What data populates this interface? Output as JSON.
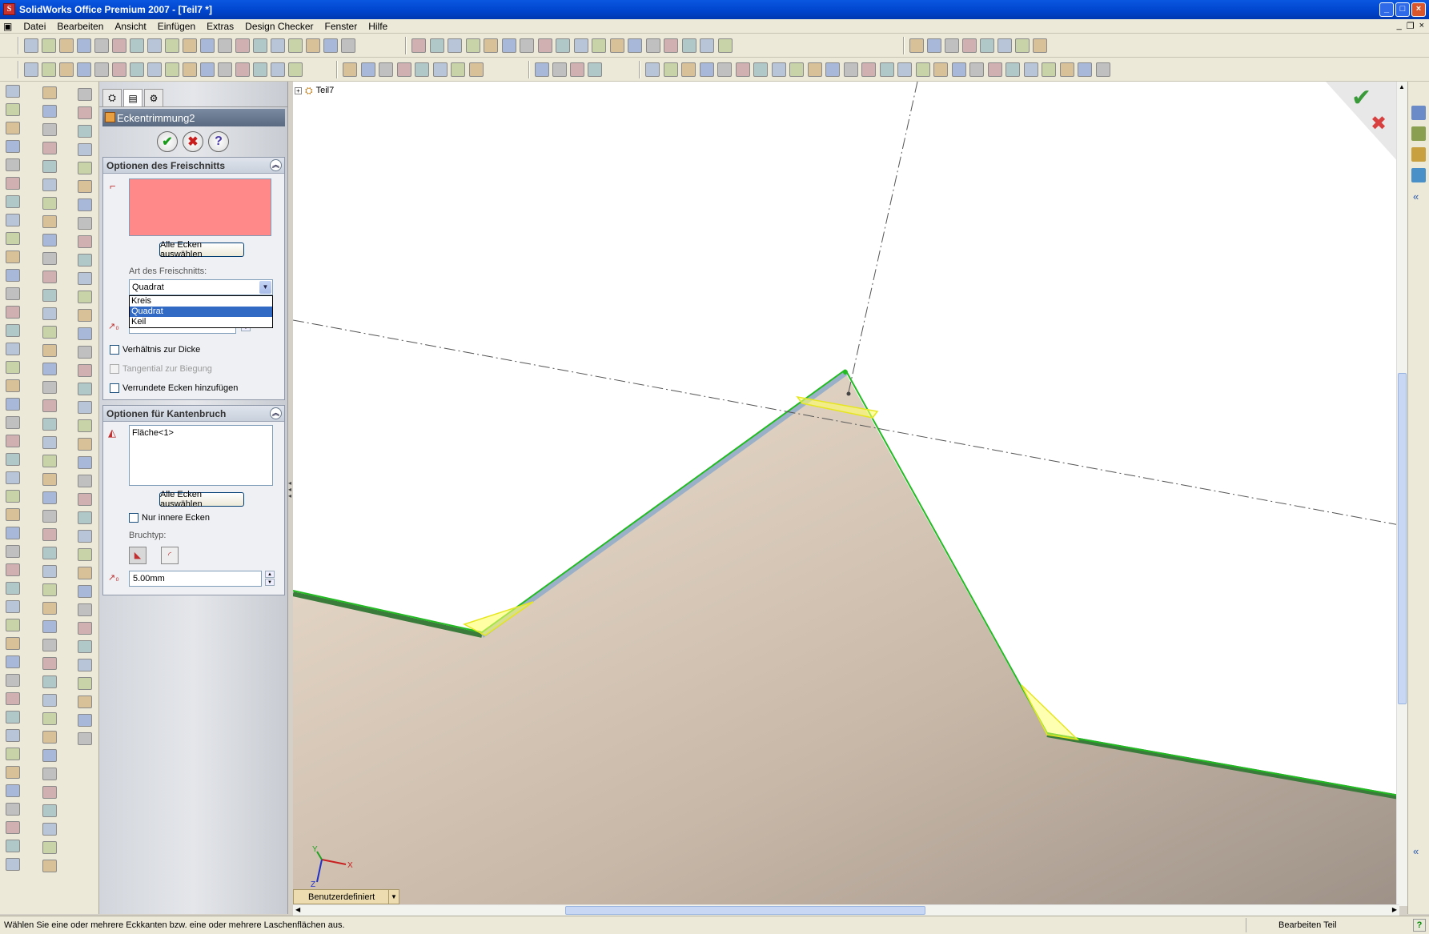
{
  "window": {
    "title": "SolidWorks Office Premium 2007 - [Teil7 *]",
    "controls": [
      "minimize",
      "maximize",
      "close"
    ]
  },
  "menubar": {
    "items": [
      "Datei",
      "Bearbeiten",
      "Ansicht",
      "Einfügen",
      "Extras",
      "Design Checker",
      "Fenster",
      "Hilfe"
    ]
  },
  "feature_tree": {
    "root_label": "Teil7"
  },
  "property_manager": {
    "title": "Eckentrimmung2",
    "group1": {
      "header": "Optionen des Freischnitts",
      "select_all_button": "Alle Ecken auswählen",
      "cut_type_label": "Art des Freischnitts:",
      "cut_type_value": "Quadrat",
      "cut_type_options": [
        "Kreis",
        "Quadrat",
        "Keil"
      ],
      "cut_type_selected": "Quadrat",
      "distance_value": "5.00mm",
      "checkbox_ratio": "Verhältnis zur Dicke",
      "checkbox_tangent": "Tangential zur Biegung",
      "checkbox_fillet": "Verrundete Ecken hinzufügen"
    },
    "group2": {
      "header": "Optionen für Kantenbruch",
      "selection_item": "Fläche<1>",
      "select_all_button": "Alle Ecken auswählen",
      "checkbox_inner": "Nur innere Ecken",
      "break_type_label": "Bruchtyp:",
      "distance_value": "5.00mm"
    }
  },
  "viewport": {
    "view_orientation": "Benutzerdefiniert",
    "axis_labels": {
      "x": "X",
      "y": "Y",
      "z": "Z"
    },
    "colors": {
      "face": "#d8c8b8",
      "edge_highlight": "#22bb22",
      "selection_face": "#ff8888",
      "background": "#ffffff"
    }
  },
  "statusbar": {
    "message": "Wählen Sie eine oder mehrere Eckkanten bzw. eine oder mehrere Laschenflächen aus.",
    "mode": "Bearbeiten Teil"
  },
  "icons": [
    "appicon",
    "ok-icon",
    "cancel-icon",
    "help-icon",
    "collapse-icon",
    "feature-manager-icon",
    "property-manager-icon",
    "configuration-manager-icon"
  ]
}
